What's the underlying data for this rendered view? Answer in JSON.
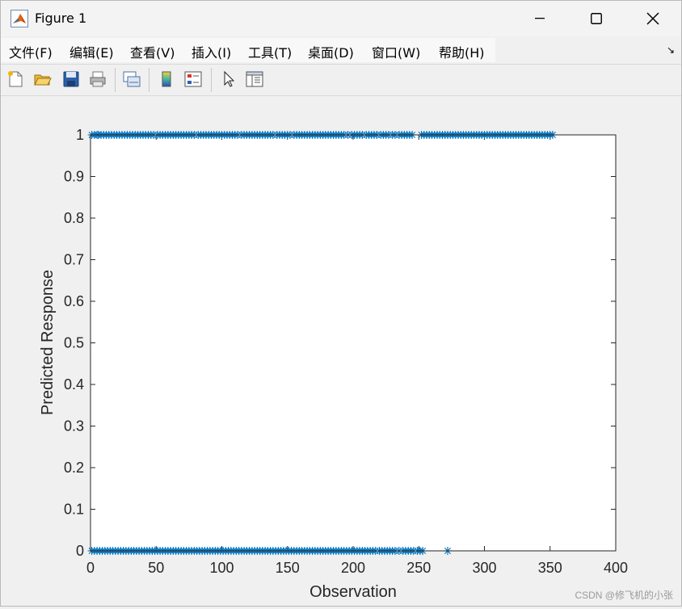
{
  "window": {
    "title": "Figure 1"
  },
  "menu": [
    {
      "label": "文件(F)"
    },
    {
      "label": "编辑(E)"
    },
    {
      "label": "查看(V)"
    },
    {
      "label": "插入(I)"
    },
    {
      "label": "工具(T)"
    },
    {
      "label": "桌面(D)"
    },
    {
      "label": "窗口(W)"
    },
    {
      "label": "帮助(H)"
    }
  ],
  "toolbar": [
    "new-figure-icon",
    "open-file-icon",
    "save-icon",
    "print-icon",
    "link-plot-icon",
    "colorbar-icon",
    "legend-icon",
    "edit-plot-icon",
    "property-inspector-icon"
  ],
  "watermark": "CSDN @修飞机的小张",
  "chart_data": {
    "type": "scatter",
    "xlabel": "Observation",
    "ylabel": "Predicted Response",
    "xlim": [
      0,
      400
    ],
    "ylim": [
      0,
      1
    ],
    "xticks": [
      "0",
      "50",
      "100",
      "150",
      "200",
      "250",
      "300",
      "350",
      "400"
    ],
    "yticks": [
      "0",
      "0.1",
      "0.2",
      "0.3",
      "0.4",
      "0.5",
      "0.6",
      "0.7",
      "0.8",
      "0.9",
      "1"
    ],
    "marker": "*",
    "marker_color": "#0072bd",
    "series": [
      {
        "values": {
          "y1_x": [
            1,
            3,
            5,
            6,
            8,
            10,
            12,
            14,
            16,
            18,
            20,
            22,
            24,
            26,
            28,
            30,
            32,
            34,
            36,
            38,
            40,
            42,
            44,
            46,
            48,
            51,
            53,
            55,
            57,
            59,
            61,
            63,
            65,
            67,
            69,
            71,
            73,
            75,
            77,
            79,
            82,
            84,
            86,
            88,
            90,
            92,
            94,
            96,
            98,
            100,
            102,
            104,
            106,
            108,
            110,
            112,
            115,
            117,
            119,
            121,
            123,
            125,
            127,
            129,
            131,
            133,
            135,
            137,
            139,
            142,
            144,
            146,
            148,
            150,
            152,
            155,
            157,
            159,
            161,
            163,
            165,
            167,
            169,
            171,
            173,
            175,
            177,
            179,
            181,
            183,
            185,
            187,
            189,
            191,
            193,
            196,
            199,
            201,
            203,
            205,
            207,
            210,
            212,
            214,
            216,
            218,
            221,
            223,
            225,
            227,
            230,
            232,
            235,
            237,
            239,
            241,
            243,
            245,
            252,
            254,
            256,
            258,
            260,
            262,
            264,
            266,
            268,
            270,
            272,
            274,
            276,
            278,
            280,
            282,
            284,
            286,
            288,
            290,
            292,
            294,
            296,
            298,
            300,
            302,
            304,
            306,
            308,
            310,
            312,
            314,
            316,
            318,
            320,
            322,
            324,
            326,
            328,
            330,
            332,
            334,
            336,
            338,
            340,
            342,
            344,
            346,
            348,
            350,
            352
          ],
          "y0_x": [
            1,
            3,
            5,
            7,
            9,
            11,
            13,
            15,
            17,
            19,
            21,
            23,
            25,
            27,
            29,
            31,
            33,
            35,
            37,
            39,
            41,
            43,
            45,
            47,
            49,
            51,
            53,
            55,
            57,
            59,
            61,
            63,
            65,
            67,
            69,
            71,
            73,
            75,
            77,
            79,
            81,
            83,
            85,
            87,
            89,
            91,
            93,
            95,
            97,
            99,
            101,
            103,
            105,
            107,
            109,
            111,
            113,
            115,
            117,
            119,
            121,
            123,
            125,
            127,
            129,
            131,
            133,
            135,
            137,
            139,
            141,
            143,
            145,
            147,
            149,
            151,
            153,
            155,
            157,
            159,
            161,
            163,
            165,
            167,
            169,
            171,
            173,
            175,
            177,
            179,
            181,
            183,
            185,
            187,
            189,
            191,
            193,
            195,
            197,
            199,
            201,
            203,
            205,
            207,
            209,
            211,
            213,
            215,
            217,
            220,
            222,
            224,
            226,
            228,
            230,
            232,
            235,
            238,
            240,
            242,
            244,
            246,
            249,
            251,
            253,
            272
          ]
        }
      }
    ]
  }
}
